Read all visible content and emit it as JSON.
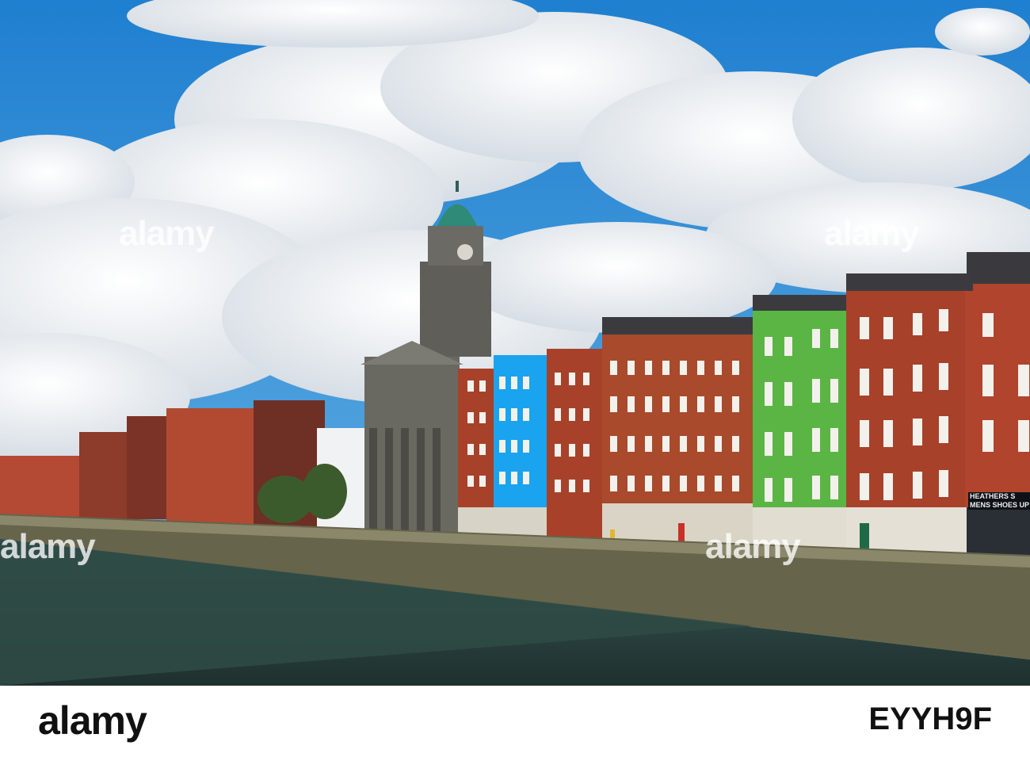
{
  "photo": {
    "subject": "river quay with colourful buildings and clock tower church"
  },
  "watermark": {
    "text": "alamy"
  },
  "shop_sign": {
    "line1": "HEATHERS S",
    "line2": "MENS SHOES UP TO S"
  },
  "footer": {
    "brand": "alamy",
    "image_id": "EYYH9F"
  },
  "colors": {
    "sky": "#2a8fd6",
    "water": "#2f4a45",
    "blue_building": "#1aa3ee",
    "green_building": "#5bb544",
    "brick": "#a8412a",
    "dome": "#2f8a78"
  }
}
